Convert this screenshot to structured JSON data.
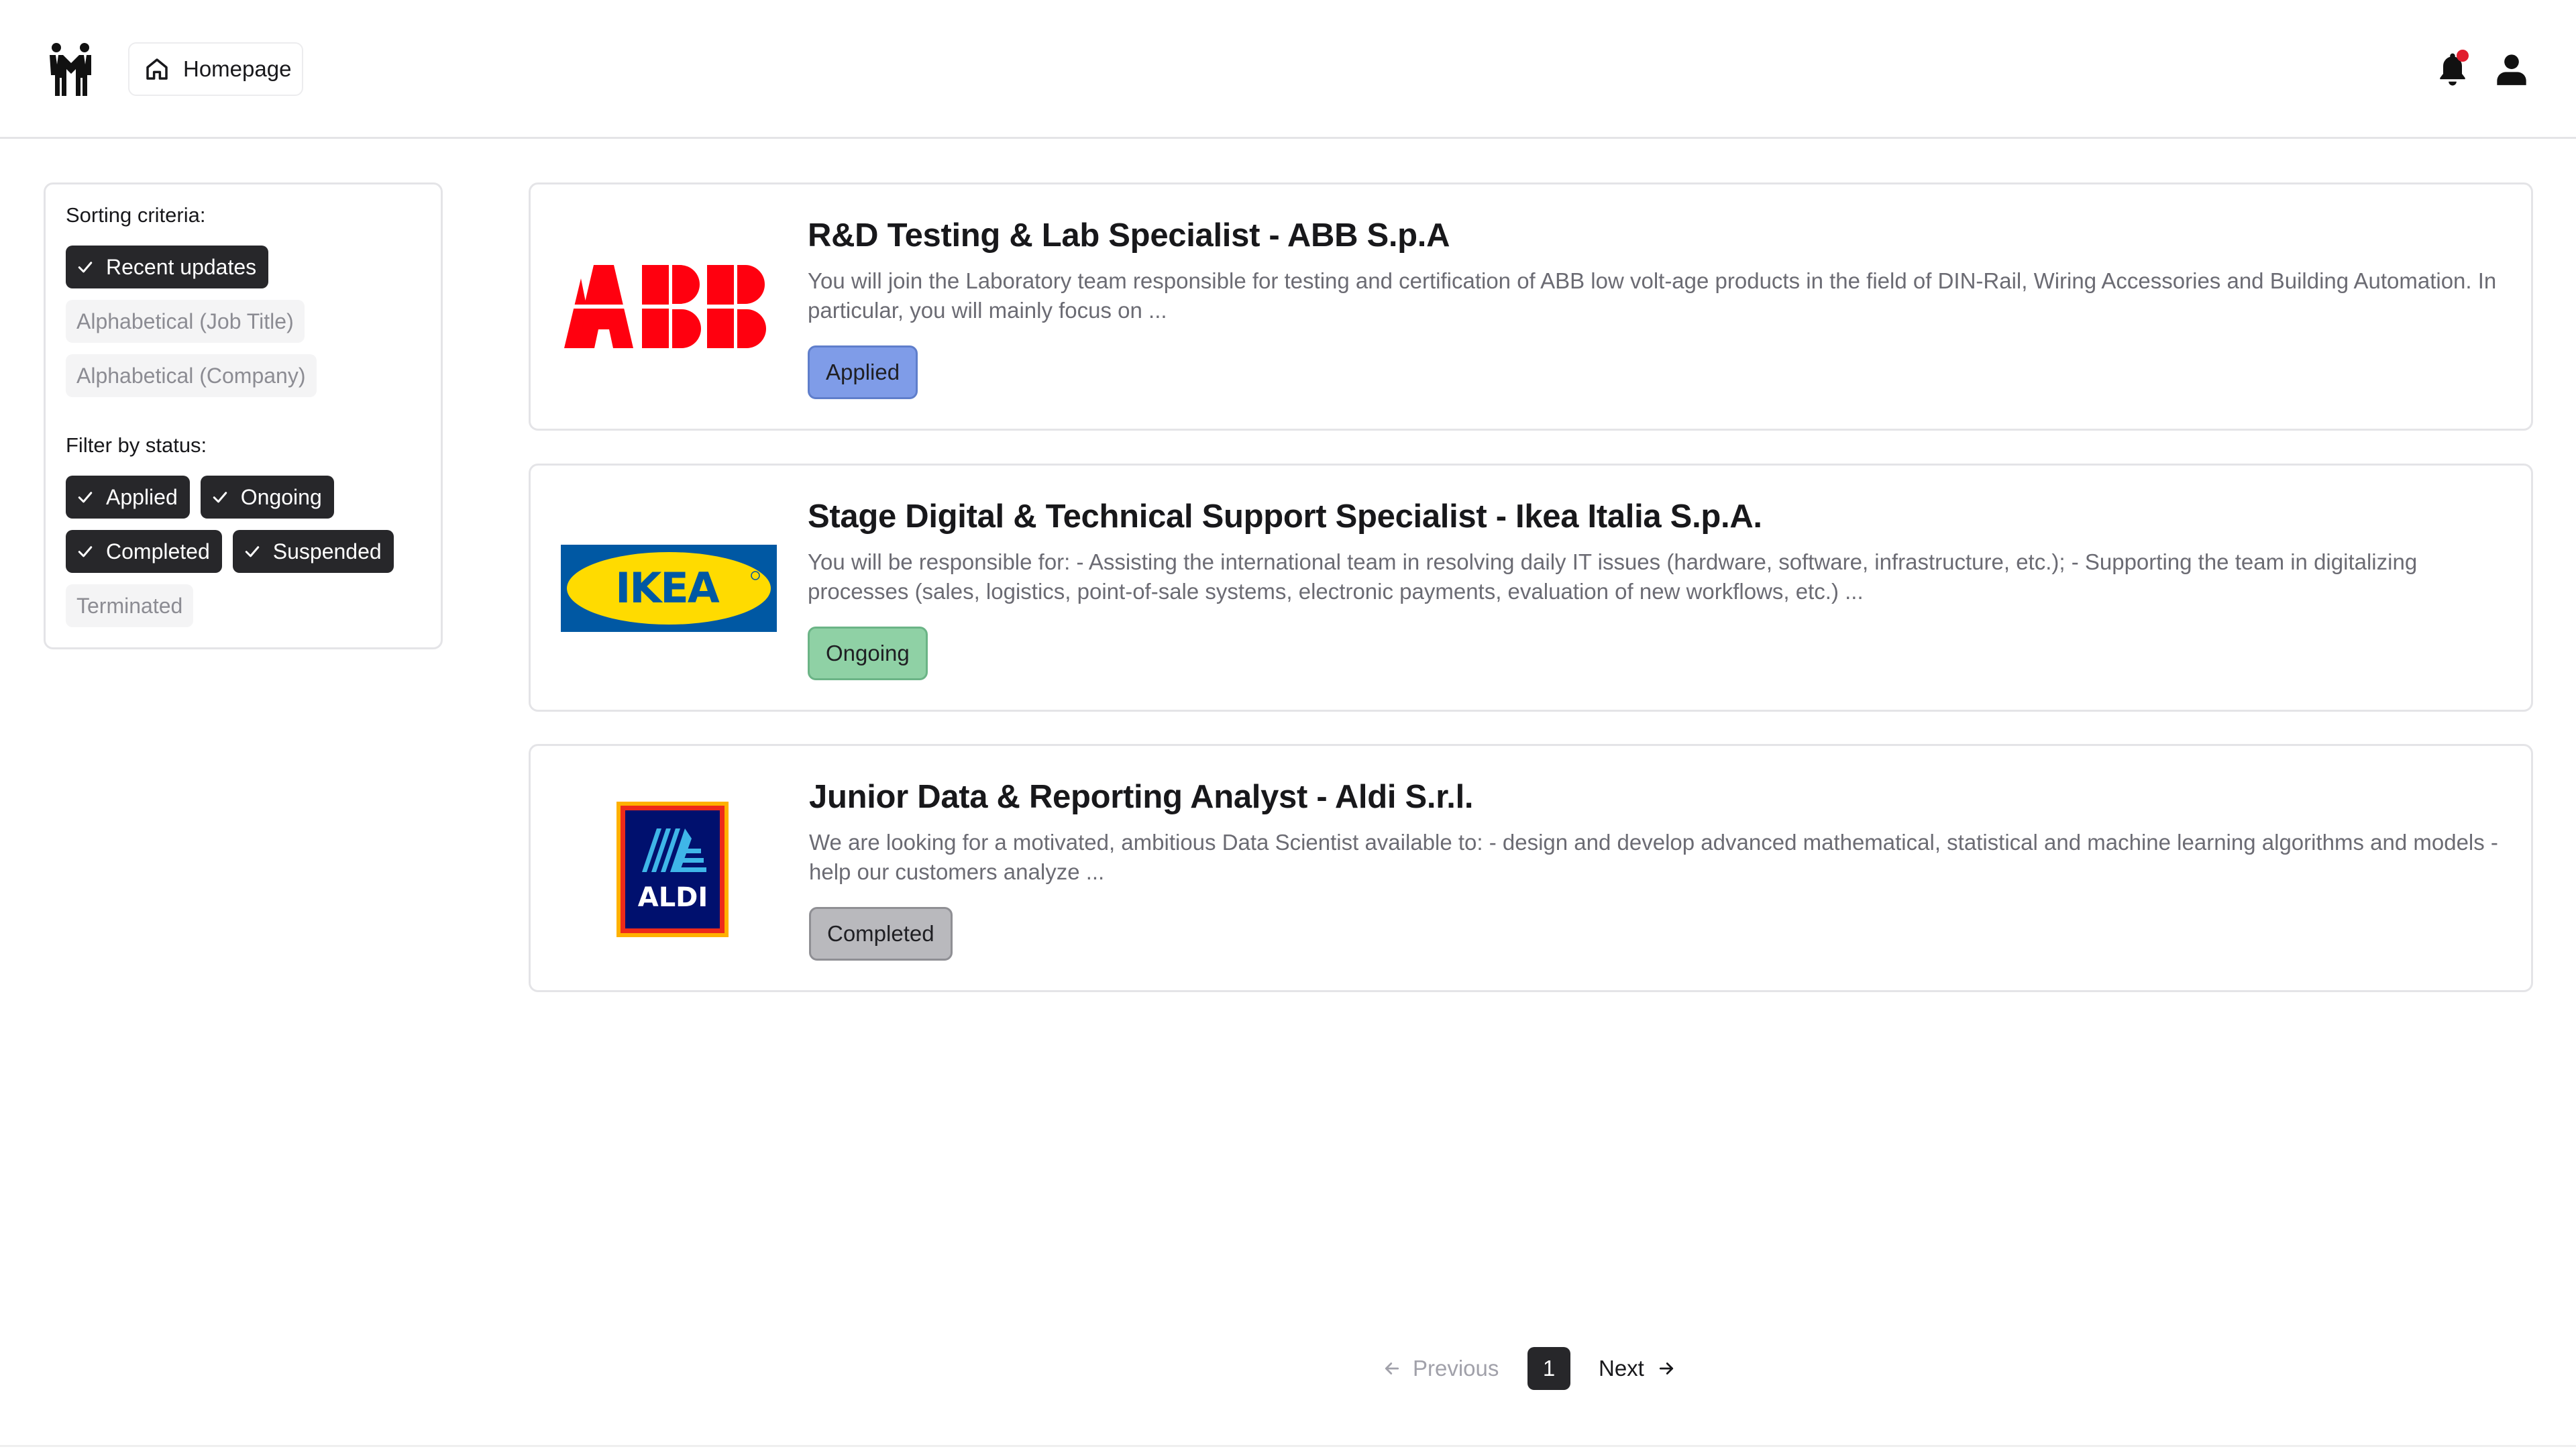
{
  "header": {
    "logo_icon": "people-handshake-icon",
    "home_label": "Homepage",
    "home_icon": "home-icon",
    "bell_icon": "bell-icon",
    "user_icon": "user-icon",
    "notification_color": "#e11d2e"
  },
  "sidebar": {
    "sort_label": "Sorting criteria:",
    "sort_options": [
      {
        "label": "Recent updates",
        "active": true
      },
      {
        "label": "Alphabetical (Job Title)",
        "active": false
      },
      {
        "label": "Alphabetical (Company)",
        "active": false
      }
    ],
    "filter_label": "Filter by status:",
    "filter_options": [
      {
        "label": "Applied",
        "active": true
      },
      {
        "label": "Ongoing",
        "active": true
      },
      {
        "label": "Completed",
        "active": true
      },
      {
        "label": "Suspended",
        "active": true
      },
      {
        "label": "Terminated",
        "active": false
      }
    ]
  },
  "jobs": [
    {
      "logo": "ABB",
      "title": "R&D Testing & Lab Specialist - ABB S.p.A",
      "description": "You will join the Laboratory team responsible for testing and  certification of ABB low volt-age products in the field of DIN-Rail,  Wiring Accessories and Building Automation. In particular, you will  mainly focus on ...",
      "status": "Applied",
      "status_color": "#7f9ce8"
    },
    {
      "logo": "IKEA",
      "title": "Stage Digital & Technical Support Specialist - Ikea Italia S.p.A.",
      "description": "You will be responsible for: - Assisting the international team in resolving daily IT issues (hardware, software, infrastructure, etc.); - Supporting the team in digitalizing processes (sales, logistics, point-of-sale systems, electronic payments, evaluation of new workflows, etc.) ...",
      "status": "Ongoing",
      "status_color": "#8fd1a5"
    },
    {
      "logo": "ALDI",
      "title": "Junior Data & Reporting Analyst - Aldi S.r.l.",
      "description": "We are looking for a motivated, ambitious Data Scientist available to: - design and develop advanced mathematical, statistical and machine learning algorithms and models - help our customers analyze ...",
      "status": "Completed",
      "status_color": "#b9b9bd"
    }
  ],
  "pagination": {
    "prev_label": "Previous",
    "current_page": "1",
    "next_label": "Next"
  }
}
